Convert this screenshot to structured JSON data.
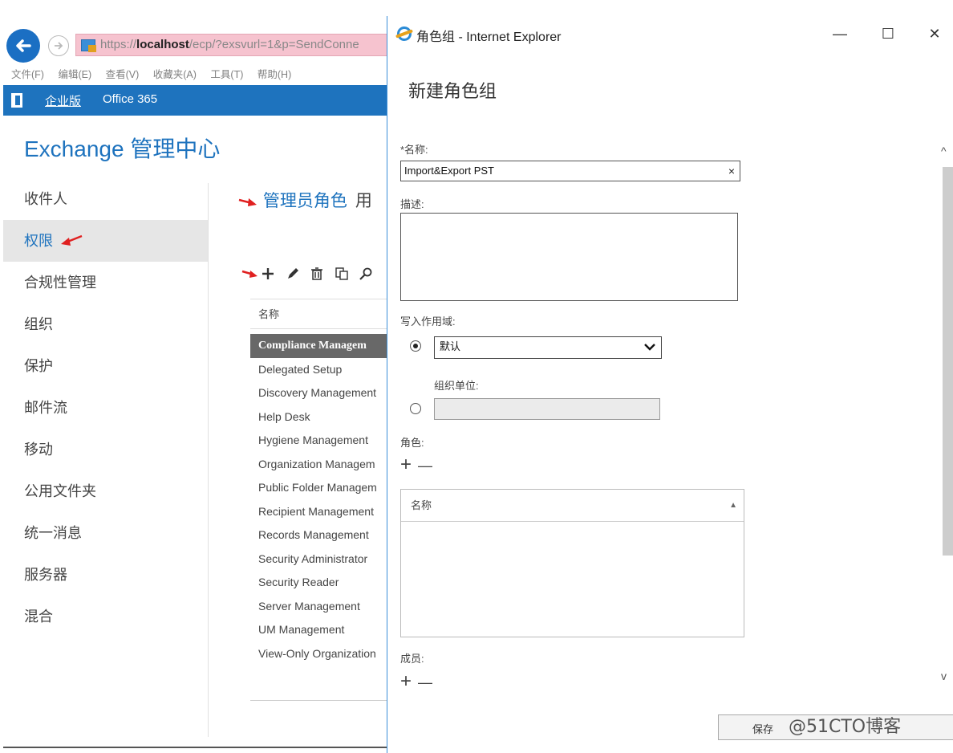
{
  "browser": {
    "url_prefix": "https://",
    "url_host": "localhost",
    "url_rest": "/ecp/?exsvurl=1&p=SendConne",
    "menu": [
      "文件(F)",
      "编辑(E)",
      "查看(V)",
      "收藏夹(A)",
      "工具(T)",
      "帮助(H)"
    ],
    "accent_color": "#1e73be"
  },
  "topbar": {
    "edition": "企业版",
    "office": "Office 365"
  },
  "app": {
    "title": "Exchange 管理中心"
  },
  "nav": {
    "items": [
      {
        "label": "收件人"
      },
      {
        "label": "权限"
      },
      {
        "label": "合规性管理"
      },
      {
        "label": "组织"
      },
      {
        "label": "保护"
      },
      {
        "label": "邮件流"
      },
      {
        "label": "移动"
      },
      {
        "label": "公用文件夹"
      },
      {
        "label": "统一消息"
      },
      {
        "label": "服务器"
      },
      {
        "label": "混合"
      }
    ]
  },
  "main": {
    "heading": "管理员角色",
    "heading_after": "用"
  },
  "role_groups": {
    "column": "名称",
    "rows": [
      "Compliance Managem",
      "Delegated Setup",
      "Discovery Management",
      "Help Desk",
      "Hygiene Management",
      "Organization Managem",
      "Public Folder Managem",
      "Recipient Management",
      "Records Management",
      "Security Administrator",
      "Security Reader",
      "Server Management",
      "UM Management",
      "View-Only Organization"
    ]
  },
  "dialog": {
    "window_title": "角色组 - Internet Explorer",
    "minimize": "—",
    "maximize": "☐",
    "close": "✕",
    "heading": "新建角色组",
    "name_label": "*名称:",
    "name_value": "Import&Export PST",
    "clear": "×",
    "desc_label": "描述:",
    "scope_label": "写入作用域:",
    "scope_selected": "默认",
    "ou_label": "组织单位:",
    "roles_label": "角色:",
    "roles_column": "名称",
    "sort_indicator": "▲",
    "members_label": "成员:",
    "plus": "+",
    "minus": "—",
    "save": "保存",
    "watermark": "@51CTO博客",
    "scroll_up": "^",
    "scroll_down": "v"
  }
}
